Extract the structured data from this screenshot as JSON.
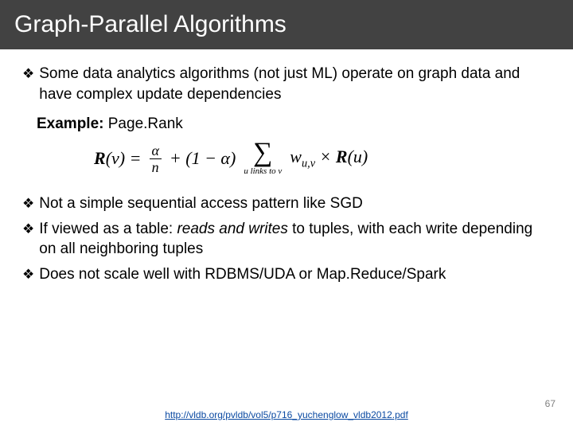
{
  "title": "Graph-Parallel Algorithms",
  "bullets": {
    "b1": "Some data analytics algorithms (not just ML) operate on graph data and have complex update dependencies",
    "b2": "Not a simple sequential access pattern like SGD",
    "b3_pre": "If viewed as a table: ",
    "b3_em": "reads and writes",
    "b3_post": " to tuples, with each write depending on all neighboring tuples",
    "b4": "Does not scale well with RDBMS/UDA or Map.Reduce/Spark"
  },
  "example": {
    "label_bold": "Example:",
    "label_rest": " Page.Rank"
  },
  "formula": {
    "lhs_b": "R",
    "lhs_v": "(v) = ",
    "frac1_num": "α",
    "frac1_den": "n",
    "plus": " + (1 − α) ",
    "sum_sub": "u links to v",
    "w": "w",
    "w_sub": "u,v",
    "times": " × ",
    "rhs_b": "R",
    "rhs_u": "(u)"
  },
  "footer": {
    "link_text": "http://vldb.org/pvldb/vol5/p716_yuchenglow_vldb2012.pdf",
    "link_href": "http://vldb.org/pvldb/vol5/p716_yuchenglow_vldb2012.pdf"
  },
  "page_number": "67",
  "bullet_glyph": "❖"
}
